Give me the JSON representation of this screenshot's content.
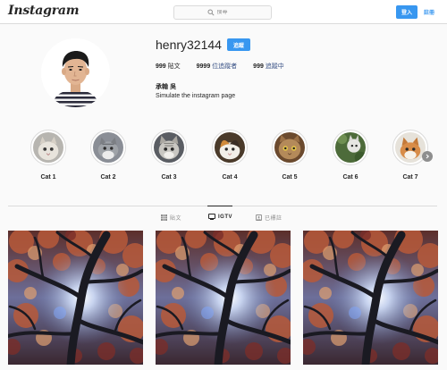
{
  "header": {
    "logo_text": "Instagram",
    "search_placeholder": "搜尋",
    "login_label": "登入",
    "register_label": "註冊"
  },
  "profile": {
    "username": "henry32144",
    "follow_label": "追蹤",
    "posts_count": "999",
    "posts_label": "貼文",
    "followers_count": "9999",
    "followers_label": "位追蹤者",
    "following_count": "999",
    "following_label": "追蹤中",
    "full_name": "承翰 吳",
    "bio": "Simulate the instagram page"
  },
  "highlights": [
    {
      "label": "Cat 1"
    },
    {
      "label": "Cat 2"
    },
    {
      "label": "Cat 3"
    },
    {
      "label": "Cat 4"
    },
    {
      "label": "Cat 5"
    },
    {
      "label": "Cat 6"
    },
    {
      "label": "Cat 7"
    }
  ],
  "tabs": [
    {
      "label": "貼文",
      "icon": "grid-icon",
      "active": false
    },
    {
      "label": "IGTV",
      "icon": "tv-icon",
      "active": true
    },
    {
      "label": "已標註",
      "icon": "tag-icon",
      "active": false
    }
  ],
  "colors": {
    "accent": "#3897f0",
    "link": "#385185",
    "border": "#dbdbdb",
    "background": "#fafafa"
  }
}
